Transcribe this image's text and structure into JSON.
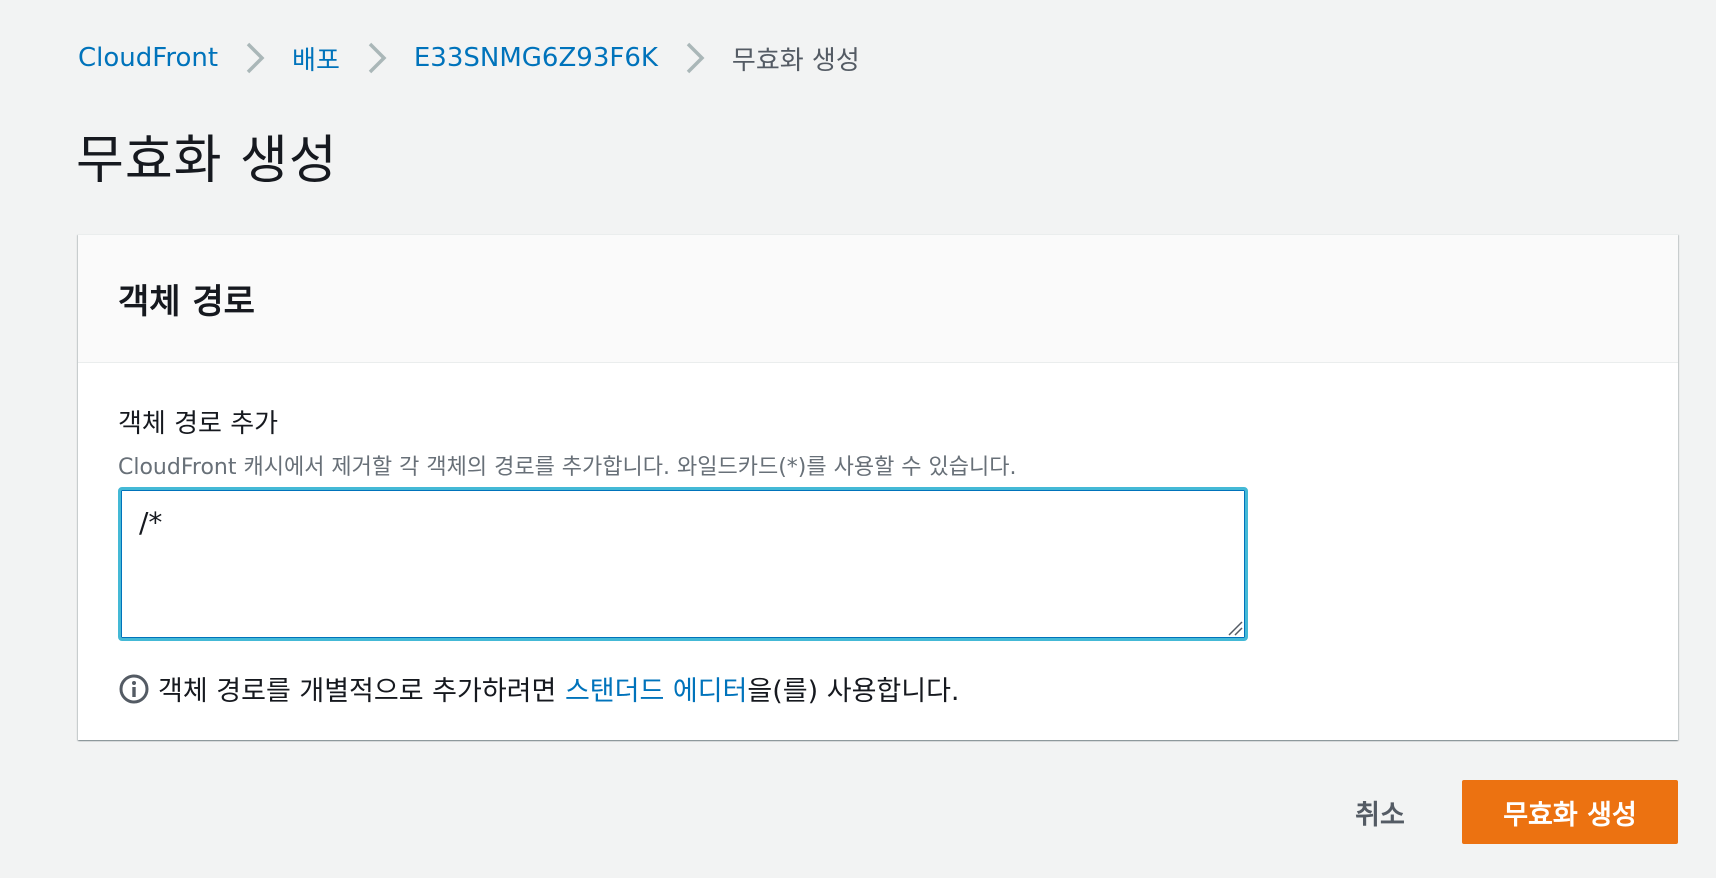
{
  "breadcrumb": {
    "items": [
      {
        "label": "CloudFront"
      },
      {
        "label": "배포"
      },
      {
        "label": "E33SNMG6Z93F6K"
      },
      {
        "label": "무효화 생성"
      }
    ]
  },
  "page": {
    "title": "무효화 생성"
  },
  "panel": {
    "title": "객체 경로",
    "field_label": "객체 경로 추가",
    "field_description": "CloudFront 캐시에서 제거할 각 객체의 경로를 추가합니다. 와일드카드(*)를 사용할 수 있습니다.",
    "paths_value": "/*",
    "info_prefix": "객체 경로를 개별적으로 추가하려면 ",
    "info_link": "스탠더드 에디터",
    "info_suffix": "을(를) 사용합니다."
  },
  "actions": {
    "cancel_label": "취소",
    "submit_label": "무효화 생성"
  },
  "colors": {
    "link": "#0073bb",
    "primary_button": "#ec7211",
    "focus_border": "#44b9d6",
    "background": "#f2f3f3"
  }
}
